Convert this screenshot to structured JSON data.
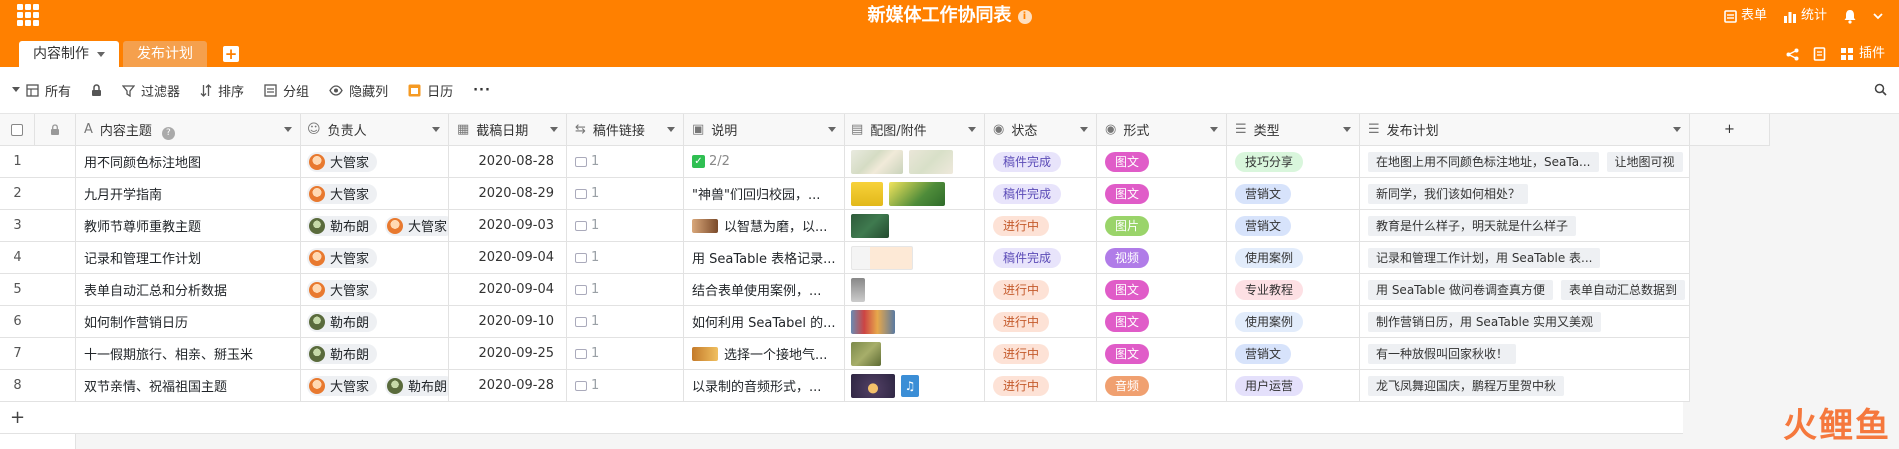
{
  "app": {
    "title": "新媒体工作协同表",
    "header_right": {
      "form": "表单",
      "stats": "统计"
    },
    "sub_right": {
      "plugins": "插件"
    }
  },
  "tabs": [
    {
      "label": "内容制作",
      "active": true
    },
    {
      "label": "发布计划",
      "active": false
    }
  ],
  "toolbar": {
    "view": "所有",
    "filter": "过滤器",
    "sort": "排序",
    "group": "分组",
    "hide": "隐藏列",
    "calendar": "日历",
    "more": "···"
  },
  "columns": {
    "topic": "内容主题",
    "owner": "负责人",
    "date": "截稿日期",
    "link": "稿件链接",
    "desc": "说明",
    "image": "配图/附件",
    "status": "状态",
    "form": "形式",
    "type": "类型",
    "plan": "发布计划",
    "add": "+"
  },
  "colors": {
    "brand": "#ff8000",
    "status_done_bg": "#e8e4fb",
    "status_progress_bg": "#fde2d6",
    "form_text_bg": "#e05cc8",
    "form_video_bg": "#b07ce8",
    "form_pic_bg": "#9ad46a",
    "form_audio_bg": "#f0a070"
  },
  "rows": [
    {
      "idx": "1",
      "topic": "用不同颜色标注地图",
      "owners": [
        "大管家"
      ],
      "owner_avatars": [
        "orange"
      ],
      "date": "2020-08-28",
      "link": "1",
      "desc": "2/2",
      "desc_kind": "check",
      "images": [
        "map",
        "map2"
      ],
      "status": "稿件完成",
      "status_kind": "done",
      "form": "图文",
      "form_kind": "text",
      "type": "技巧分享",
      "type_bg": "#d9f6dc",
      "plan": [
        "在地图上用不同颜色标注地址，SeaTa...",
        "让地图可视"
      ]
    },
    {
      "idx": "2",
      "topic": "九月开学指南",
      "owners": [
        "大管家"
      ],
      "owner_avatars": [
        "orange"
      ],
      "date": "2020-08-29",
      "link": "1",
      "desc": "\"神兽\"们回归校园，...",
      "desc_kind": "text",
      "images": [
        "yellow",
        "green"
      ],
      "status": "稿件完成",
      "status_kind": "done",
      "form": "图文",
      "form_kind": "text",
      "type": "营销文",
      "type_bg": "#d7e3fb",
      "plan": [
        "新同学，我们该如何相处？"
      ]
    },
    {
      "idx": "3",
      "topic": "教师节尊师重教主题",
      "owners": [
        "勒布朗",
        "大管家"
      ],
      "owner_avatars": [
        "green",
        "orange"
      ],
      "date": "2020-09-03",
      "link": "1",
      "desc": "以智慧为磨，以...",
      "desc_kind": "thumb",
      "images": [
        "chalk"
      ],
      "status": "进行中",
      "status_kind": "progress",
      "form": "图片",
      "form_kind": "pic",
      "type": "营销文",
      "type_bg": "#d7e3fb",
      "plan": [
        "教育是什么样子，明天就是什么样子"
      ]
    },
    {
      "idx": "4",
      "topic": "记录和管理工作计划",
      "owners": [
        "大管家"
      ],
      "owner_avatars": [
        "orange"
      ],
      "date": "2020-09-04",
      "link": "1",
      "desc": "用 SeaTable 表格记录...",
      "desc_kind": "text",
      "images": [
        "sheet"
      ],
      "status": "稿件完成",
      "status_kind": "done",
      "form": "视频",
      "form_kind": "video",
      "type": "使用案例",
      "type_bg": "#e2ecfb",
      "plan": [
        "记录和管理工作计划，用 SeaTable 表..."
      ]
    },
    {
      "idx": "5",
      "topic": "表单自动汇总和分析数据",
      "owners": [
        "大管家"
      ],
      "owner_avatars": [
        "orange"
      ],
      "date": "2020-09-04",
      "link": "1",
      "desc": "结合表单使用案例，...",
      "desc_kind": "text",
      "images": [
        "form"
      ],
      "status": "进行中",
      "status_kind": "progress",
      "form": "图文",
      "form_kind": "text",
      "type": "专业教程",
      "type_bg": "#fde0e4",
      "plan": [
        "用 SeaTable 做问卷调查真方便",
        "表单自动汇总数据到"
      ]
    },
    {
      "idx": "6",
      "topic": "如何制作营销日历",
      "owners": [
        "勒布朗"
      ],
      "owner_avatars": [
        "green"
      ],
      "date": "2020-09-10",
      "link": "1",
      "desc": "如何利用 SeaTabel 的...",
      "desc_kind": "text",
      "images": [
        "calendar"
      ],
      "status": "进行中",
      "status_kind": "progress",
      "form": "图文",
      "form_kind": "text",
      "type": "使用案例",
      "type_bg": "#e2ecfb",
      "plan": [
        "制作营销日历，用 SeaTable 实用又美观"
      ]
    },
    {
      "idx": "7",
      "topic": "十一假期旅行、相亲、掰玉米",
      "owners": [
        "勒布朗"
      ],
      "owner_avatars": [
        "green"
      ],
      "date": "2020-09-25",
      "link": "1",
      "desc": "选择一个接地气...",
      "desc_kind": "thumb",
      "images": [
        "field"
      ],
      "status": "进行中",
      "status_kind": "progress",
      "form": "图文",
      "form_kind": "text",
      "type": "营销文",
      "type_bg": "#d7e3fb",
      "plan": [
        "有一种放假叫回家秋收！"
      ]
    },
    {
      "idx": "8",
      "topic": "双节亲情、祝福祖国主题",
      "owners": [
        "大管家",
        "勒布朗"
      ],
      "owner_avatars": [
        "orange",
        "green"
      ],
      "date": "2020-09-28",
      "link": "1",
      "desc": "以录制的音频形式，...",
      "desc_kind": "text",
      "images": [
        "moon",
        "music"
      ],
      "status": "进行中",
      "status_kind": "progress",
      "form": "音频",
      "form_kind": "audio",
      "type": "用户运营",
      "type_bg": "#e4e0fb",
      "plan": [
        "龙飞凤舞迎国庆，鹏程万里贺中秋"
      ]
    }
  ],
  "add_row": "+",
  "watermark": "火鲤鱼"
}
